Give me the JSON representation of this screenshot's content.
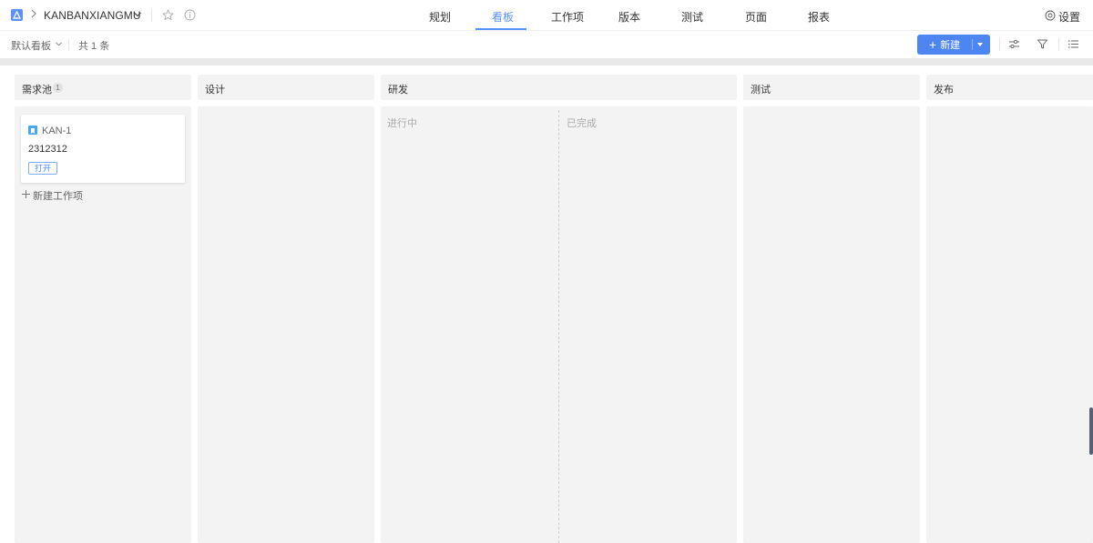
{
  "header": {
    "project_name": "KANBANXIANGMU",
    "tabs": [
      {
        "label": "规划"
      },
      {
        "label": "看板"
      },
      {
        "label": "工作项"
      },
      {
        "label": "版本"
      },
      {
        "label": "测试"
      },
      {
        "label": "页面"
      },
      {
        "label": "报表"
      }
    ],
    "active_tab": "看板",
    "settings_label": "设置"
  },
  "toolbar": {
    "board_select": "默认看板",
    "count": "共 1 条",
    "new_label": "新建"
  },
  "board": {
    "columns": [
      {
        "title": "需求池",
        "badge": "1"
      },
      {
        "title": "设计"
      },
      {
        "title": "研发",
        "sub_columns": [
          "进行中",
          "已完成"
        ]
      },
      {
        "title": "测试"
      },
      {
        "title": "发布"
      }
    ],
    "card": {
      "key": "KAN-1",
      "title": "2312312",
      "status": "打开"
    },
    "add_item_label": "新建工作项"
  },
  "colors": {
    "accent": "#4d86f0",
    "column_bg": "#f3f3f3",
    "story_icon": "#45a9f0"
  }
}
